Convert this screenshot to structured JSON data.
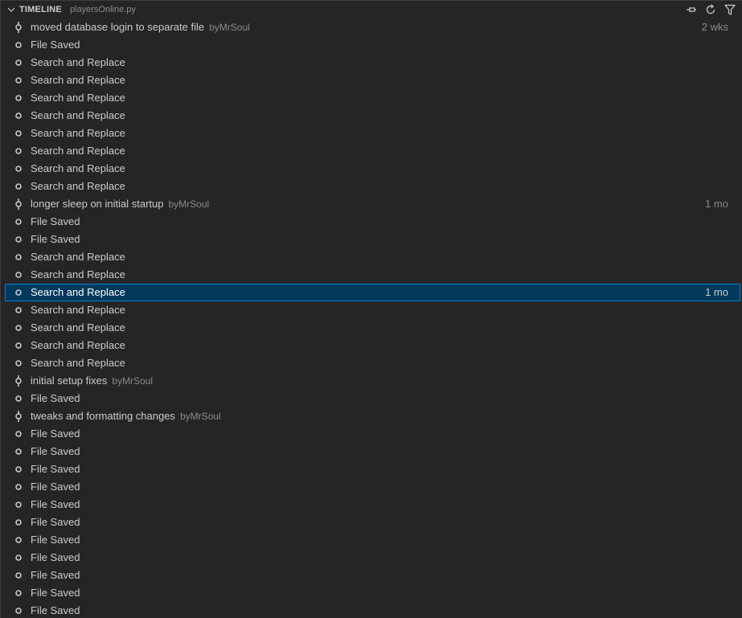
{
  "header": {
    "title": "TIMELINE",
    "file": "playersOnline.py",
    "icons": [
      "pin-icon",
      "refresh-icon",
      "filter-icon"
    ]
  },
  "selected_index": 15,
  "items": [
    {
      "label": "moved database login to separate file",
      "author": "byMrSoul",
      "time": "2 wks",
      "type": "commit"
    },
    {
      "label": "File Saved",
      "type": "save"
    },
    {
      "label": "Search and Replace",
      "type": "save"
    },
    {
      "label": "Search and Replace",
      "type": "save"
    },
    {
      "label": "Search and Replace",
      "type": "save"
    },
    {
      "label": "Search and Replace",
      "type": "save"
    },
    {
      "label": "Search and Replace",
      "type": "save"
    },
    {
      "label": "Search and Replace",
      "type": "save"
    },
    {
      "label": "Search and Replace",
      "type": "save"
    },
    {
      "label": "Search and Replace",
      "type": "save"
    },
    {
      "label": "longer sleep on initial startup",
      "author": "byMrSoul",
      "time": "1 mo",
      "type": "commit"
    },
    {
      "label": "File Saved",
      "type": "save"
    },
    {
      "label": "File Saved",
      "type": "save"
    },
    {
      "label": "Search and Replace",
      "type": "save"
    },
    {
      "label": "Search and Replace",
      "type": "save"
    },
    {
      "label": "Search and Replace",
      "time": "1 mo",
      "type": "save"
    },
    {
      "label": "Search and Replace",
      "type": "save"
    },
    {
      "label": "Search and Replace",
      "type": "save"
    },
    {
      "label": "Search and Replace",
      "type": "save"
    },
    {
      "label": "Search and Replace",
      "type": "save"
    },
    {
      "label": "initial setup fixes",
      "author": "byMrSoul",
      "type": "commit"
    },
    {
      "label": "File Saved",
      "type": "save"
    },
    {
      "label": "tweaks and formatting changes",
      "author": "byMrSoul",
      "type": "commit"
    },
    {
      "label": "File Saved",
      "type": "save"
    },
    {
      "label": "File Saved",
      "type": "save"
    },
    {
      "label": "File Saved",
      "type": "save"
    },
    {
      "label": "File Saved",
      "type": "save"
    },
    {
      "label": "File Saved",
      "type": "save"
    },
    {
      "label": "File Saved",
      "type": "save"
    },
    {
      "label": "File Saved",
      "type": "save"
    },
    {
      "label": "File Saved",
      "type": "save"
    },
    {
      "label": "File Saved",
      "type": "save"
    },
    {
      "label": "File Saved",
      "type": "save"
    },
    {
      "label": "File Saved",
      "type": "save"
    }
  ],
  "colors": {
    "background": "#252526",
    "selection": "#04395e",
    "selection_border": "#007fd4",
    "text": "#cccccc",
    "muted": "#8b8b8b"
  }
}
